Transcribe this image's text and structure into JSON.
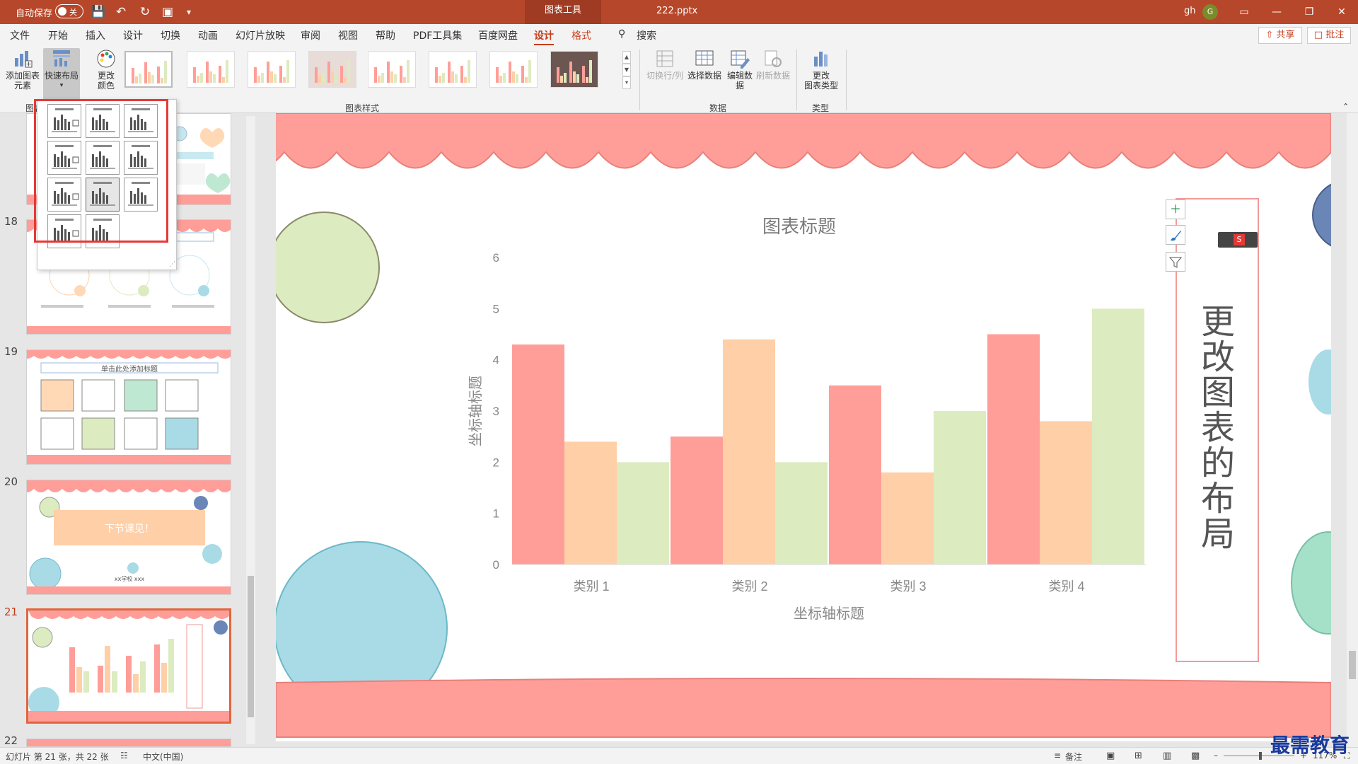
{
  "titlebar": {
    "autosave_label": "自动保存",
    "autosave_state": "关",
    "context_tab": "图表工具",
    "filename": "222.pptx",
    "user": "gh",
    "avatar_initial": "G"
  },
  "menu": {
    "tabs": [
      "文件",
      "开始",
      "插入",
      "设计",
      "切换",
      "动画",
      "幻灯片放映",
      "审阅",
      "视图",
      "帮助",
      "PDF工具集",
      "百度网盘",
      "设计",
      "格式"
    ],
    "search": "搜索",
    "share": "共享",
    "comment": "批注"
  },
  "ribbon": {
    "add_element": "添加图表\n元素",
    "quick_layout": "快速布局",
    "change_colors": "更改\n颜色",
    "group_chart_layout": "图表",
    "group_chart_styles": "图表样式",
    "switch_rowcol": "切换行/列",
    "select_data": "选择数据",
    "edit_data": "编辑数\n据",
    "refresh_data": "刷新数据",
    "group_data": "数据",
    "change_type": "更改\n图表类型",
    "group_type": "类型"
  },
  "slides": [
    {
      "num": "18"
    },
    {
      "num": "19",
      "title": "单击此处添加标题"
    },
    {
      "num": "20",
      "text": "下节课见！",
      "sub": "xx学校 xxx"
    },
    {
      "num": "21"
    },
    {
      "num": "22"
    }
  ],
  "colors": {
    "pink": "#ff9e98",
    "peach": "#ffcfa8",
    "green": "#dcebc0",
    "accent": "#b7472a"
  },
  "chart_data": {
    "type": "bar",
    "title": "图表标题",
    "xlabel": "坐标轴标题",
    "ylabel": "坐标轴标题",
    "categories": [
      "类别 1",
      "类别 2",
      "类别 3",
      "类别 4"
    ],
    "series": [
      {
        "values": [
          4.3,
          2.5,
          3.5,
          4.5
        ]
      },
      {
        "values": [
          2.4,
          4.4,
          1.8,
          2.8
        ]
      },
      {
        "values": [
          2.0,
          2.0,
          3.0,
          5.0
        ]
      }
    ],
    "ylim": [
      0,
      6
    ],
    "yticks": [
      "0",
      "1",
      "2",
      "3",
      "4",
      "5",
      "6"
    ],
    "grid": false,
    "legend": "none"
  },
  "side_text": "更改图表的布局",
  "status": {
    "slide_info": "幻灯片 第 21 张，共 22 张",
    "language": "中文(中国)",
    "notes": "备注",
    "zoom": "117%"
  },
  "watermark": "最需教育"
}
